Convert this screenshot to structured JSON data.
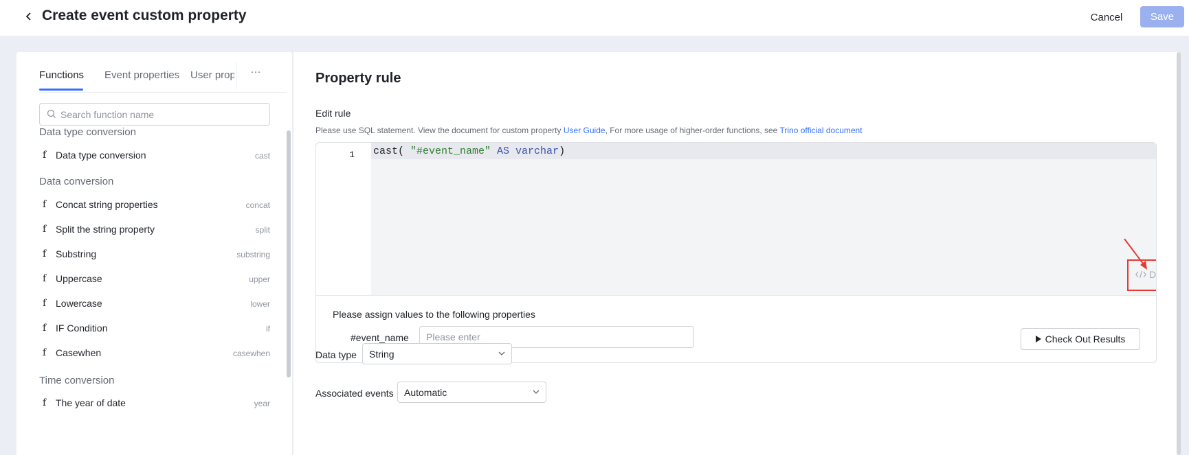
{
  "header": {
    "title": "Create event custom property",
    "cancel_label": "Cancel",
    "save_label": "Save"
  },
  "left_panel": {
    "tabs": [
      {
        "label": "Functions",
        "active": true
      },
      {
        "label": "Event properties",
        "active": false
      },
      {
        "label": "User properties",
        "active": false
      }
    ],
    "more_label": "···",
    "search_placeholder": "Search function name",
    "groups": [
      {
        "title": "Data type conversion",
        "items": [
          {
            "name": "Data type conversion",
            "code": "cast"
          }
        ]
      },
      {
        "title": "Data conversion",
        "items": [
          {
            "name": "Concat string properties",
            "code": "concat"
          },
          {
            "name": "Split the string property",
            "code": "split"
          },
          {
            "name": "Substring",
            "code": "substring"
          },
          {
            "name": "Uppercase",
            "code": "upper"
          },
          {
            "name": "Lowercase",
            "code": "lower"
          },
          {
            "name": "IF Condition",
            "code": "if"
          },
          {
            "name": "Casewhen",
            "code": "casewhen"
          }
        ]
      },
      {
        "title": "Time conversion",
        "items": [
          {
            "name": "The year of date",
            "code": "year"
          }
        ]
      }
    ],
    "fn_glyph": "f"
  },
  "main": {
    "section_title": "Property rule",
    "edit_rule_label": "Edit rule",
    "description": {
      "text1": "Please use SQL statement. View the document for custom property ",
      "link1": "User Guide",
      "text2": ",   For more usage of higher-order functions, see ",
      "link2": "Trino official document"
    },
    "editor": {
      "line_number": "1",
      "code_fn": "cast( ",
      "code_str": "\"#event_name\"",
      "code_kw": " AS varchar",
      "code_close": ")",
      "debug_label": "Debug"
    },
    "assign": {
      "title": "Please assign values to the following properties",
      "property_label": "#event_name",
      "input_placeholder": "Please enter",
      "check_button_label": "Check Out Results"
    },
    "data_type": {
      "label": "Data type",
      "value": "String"
    },
    "associated_events": {
      "label": "Associated events",
      "value": "Automatic"
    }
  },
  "colors": {
    "accent": "#3370ff",
    "save_disabled": "#9bb1ef",
    "highlight_box": "#e53935"
  }
}
